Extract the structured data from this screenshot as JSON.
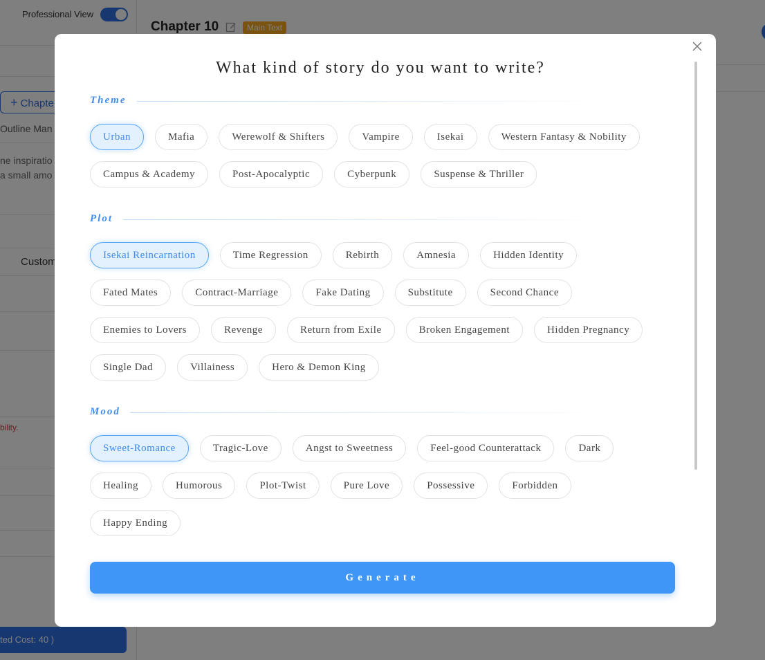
{
  "sidebar": {
    "professional_view_label": "Professional View",
    "professional_view_on": true,
    "add_chapter_label": "Chapte",
    "outline_tab_label": "Outline Man",
    "desc_line1": "ne inspiratio",
    "desc_line2": "a small amo",
    "custom_label": "Custom",
    "warning_text": "bility.",
    "cost_button_label": "ted Cost: 40 )"
  },
  "header": {
    "chapter_title": "Chapter 10",
    "badge_label": "Main Text"
  },
  "colors": {
    "accent": "#3f96f6",
    "selected_tag_bg": "#e3f0fd",
    "section_label": "#3f8ef0",
    "badge": "#f5a623"
  },
  "modal": {
    "title": "What kind of story do you want to write?",
    "sections": {
      "theme": {
        "label": "Theme",
        "rows": [
          [
            "Urban",
            "Mafia",
            "Werewolf & Shifters",
            "Vampire",
            "Isekai",
            "Western Fantasy & Nobility"
          ],
          [
            "Campus & Academy",
            "Post-Apocalyptic",
            "Cyberpunk",
            "Suspense & Thriller"
          ]
        ],
        "selected": "Urban"
      },
      "plot": {
        "label": "Plot",
        "rows": [
          [
            "Isekai Reincarnation",
            "Time Regression",
            "Rebirth",
            "Amnesia",
            "Hidden Identity"
          ],
          [
            "Fated Mates",
            "Contract-Marriage",
            "Fake Dating",
            "Substitute",
            "Second Chance"
          ],
          [
            "Enemies to Lovers",
            "Revenge",
            "Return from Exile",
            "Broken Engagement",
            "Hidden Pregnancy"
          ],
          [
            "Single Dad",
            "Villainess",
            "Hero & Demon King"
          ]
        ],
        "selected": "Isekai Reincarnation"
      },
      "mood": {
        "label": "Mood",
        "rows": [
          [
            "Sweet-Romance",
            "Tragic-Love",
            "Angst to Sweetness",
            "Feel-good Counterattack",
            "Dark"
          ],
          [
            "Healing",
            "Humorous",
            "Plot-Twist",
            "Pure Love",
            "Possessive",
            "Forbidden"
          ],
          [
            "Happy Ending"
          ]
        ],
        "selected": "Sweet-Romance"
      }
    },
    "generate_label": "Generate",
    "close_icon": "close-icon"
  }
}
